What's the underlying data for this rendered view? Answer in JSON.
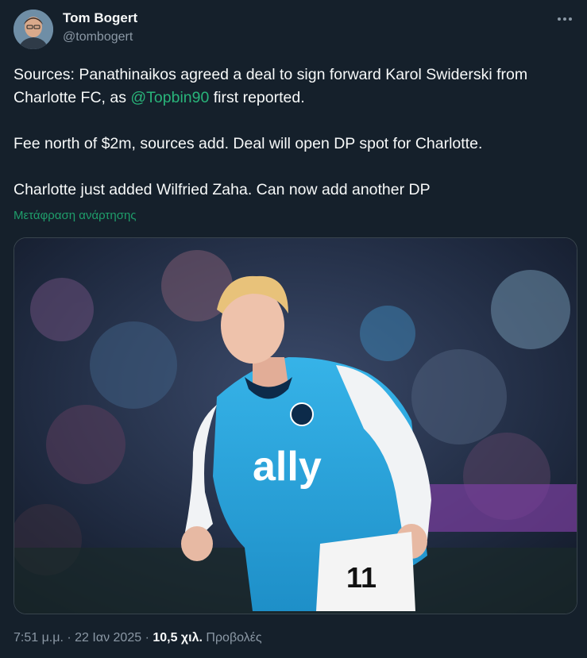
{
  "author": {
    "name": "Tom Bogert",
    "handle": "@tombogert"
  },
  "tweet": {
    "line1_pre": "Sources: Panathinaikos agreed a deal to sign forward Karol Swiderski from Charlotte FC, as ",
    "mention": "@Topbin90",
    "line1_post": " first reported.",
    "line2": "Fee north of $2m, sources add. Deal will open DP spot for Charlotte.",
    "line3": "Charlotte just added Wilfried Zaha. Can now add another DP"
  },
  "translate_label": "Μετάφραση ανάρτησης",
  "media": {
    "jersey_sponsor": "ally",
    "jersey_number": "11"
  },
  "meta": {
    "time": "7:51 μ.μ.",
    "sep1": " · ",
    "date": "22 Ιαν 2025",
    "sep2": " · ",
    "views_count": "10,5 χιλ.",
    "views_label": " Προβολές"
  },
  "colors": {
    "background": "#15202b",
    "mention": "#29b47a",
    "muted": "#8b98a5",
    "jersey": "#2aa3dc"
  },
  "icons": [
    "more-icon",
    "avatar"
  ]
}
